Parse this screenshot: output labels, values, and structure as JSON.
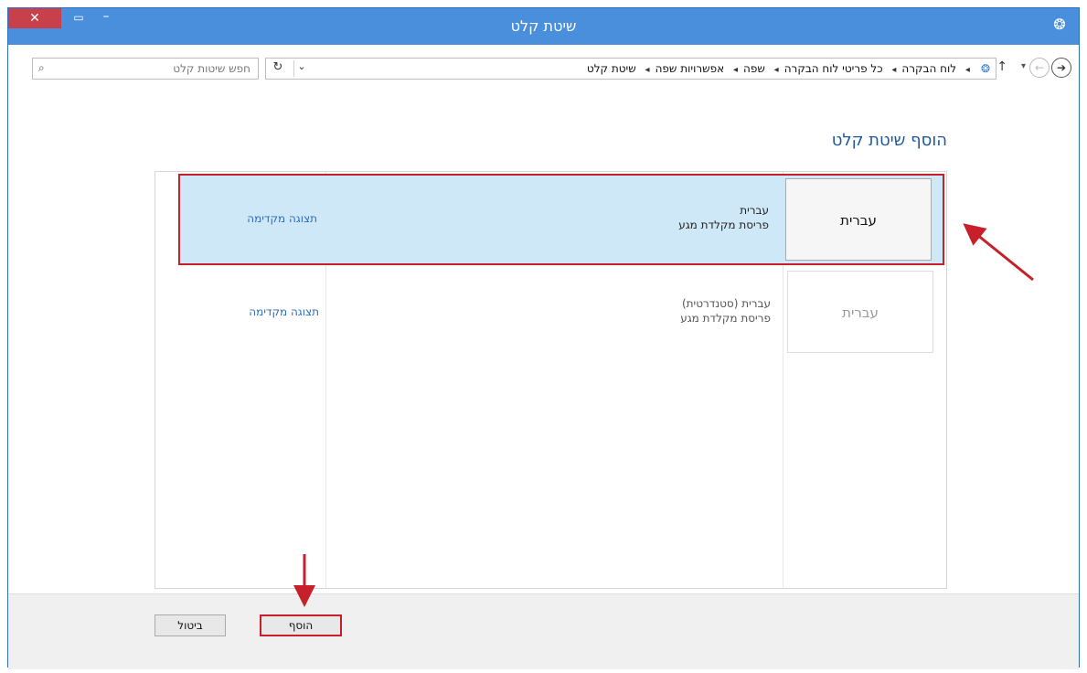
{
  "window": {
    "title": "שיטת קלט"
  },
  "address_bar": {
    "search_placeholder": "חפש שיטות קלט",
    "breadcrumb": [
      "לוח הבקרה",
      "כל פריטי לוח הבקרה",
      "שפה",
      "אפשרויות שפה",
      "שיטת קלט"
    ]
  },
  "page": {
    "heading": "הוסף שיטת קלט"
  },
  "input_methods": [
    {
      "tile": "עברית",
      "name": "עברית",
      "layout": "פריסת מקלדת מגע",
      "preview": "תצוגה מקדימה",
      "selected": true
    },
    {
      "tile": "עברית",
      "name": "עברית (סטנדרטית)",
      "layout": "פריסת מקלדת מגע",
      "preview": "תצוגה מקדימה",
      "selected": false
    }
  ],
  "footer": {
    "add_label": "הוסף",
    "cancel_label": "ביטול"
  },
  "colors": {
    "titlebar": "#4a8fdb",
    "highlight": "#cfe8f7",
    "annotation": "#c8202a",
    "link": "#2a6fc0"
  },
  "icons": [
    "close-icon",
    "maximize-icon",
    "minimize-icon",
    "globe-icon",
    "search-icon",
    "refresh-icon",
    "chevron-down-icon",
    "back-icon",
    "forward-icon",
    "up-arrow-icon",
    "control-panel-icon"
  ]
}
